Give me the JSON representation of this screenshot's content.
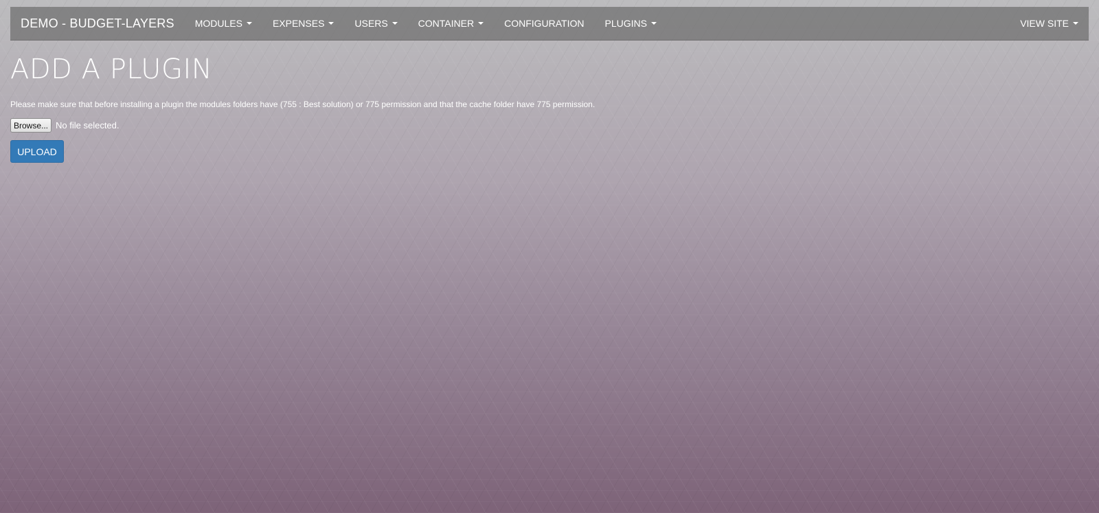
{
  "navbar": {
    "brand": "DEMO - BUDGET-LAYERS",
    "items": [
      {
        "label": "MODULES",
        "dropdown": true
      },
      {
        "label": "EXPENSES",
        "dropdown": true
      },
      {
        "label": "USERS",
        "dropdown": true
      },
      {
        "label": "CONTAINER",
        "dropdown": true
      },
      {
        "label": "CONFIGURATION",
        "dropdown": false
      },
      {
        "label": "PLUGINS",
        "dropdown": true
      }
    ],
    "right_item": {
      "label": "VIEW SITE",
      "dropdown": true
    }
  },
  "page": {
    "title": "ADD A PLUGIN",
    "notice": "Please make sure that before installing a plugin the modules folders have (755 : Best solution) or 775 permission and that the cache folder have 775 permission."
  },
  "file_input": {
    "browse_label": "Browse...",
    "status": "No file selected."
  },
  "upload_label": "UPLOAD",
  "colors": {
    "navbar_bg": "#6e6e6e",
    "upload_button": "#337ab7"
  }
}
